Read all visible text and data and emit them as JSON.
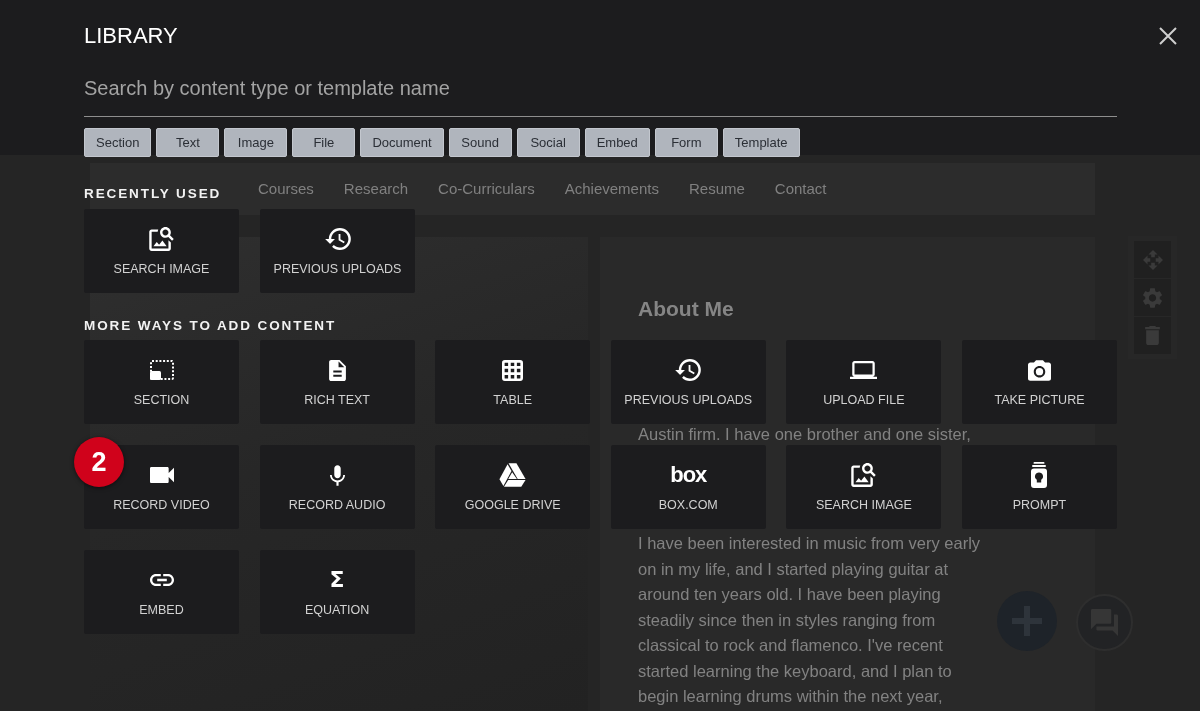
{
  "library": {
    "title": "LIBRARY",
    "search": {
      "placeholder": "Search by content type or template name"
    },
    "filters": [
      "Section",
      "Text",
      "Image",
      "File",
      "Document",
      "Sound",
      "Social",
      "Embed",
      "Form",
      "Template"
    ],
    "recently_used": {
      "heading": "RECENTLY USED",
      "tiles": [
        {
          "kind": "searchimage",
          "label": "SEARCH IMAGE"
        },
        {
          "kind": "uploads",
          "label": "PREVIOUS UPLOADS"
        }
      ]
    },
    "more_ways": {
      "heading": "MORE WAYS TO ADD CONTENT",
      "tiles": [
        {
          "kind": "section",
          "label": "SECTION"
        },
        {
          "kind": "richtext",
          "label": "RICH TEXT"
        },
        {
          "kind": "table",
          "label": "TABLE"
        },
        {
          "kind": "uploads",
          "label": "PREVIOUS UPLOADS"
        },
        {
          "kind": "uploadfile",
          "label": "UPLOAD FILE"
        },
        {
          "kind": "takepicture",
          "label": "TAKE PICTURE"
        },
        {
          "kind": "recordvideo",
          "label": "RECORD VIDEO",
          "badge": "2"
        },
        {
          "kind": "recordaudio",
          "label": "RECORD AUDIO"
        },
        {
          "kind": "drive",
          "label": "GOOGLE DRIVE"
        },
        {
          "kind": "wordmark",
          "glyph": "box",
          "label": "BOX.COM"
        },
        {
          "kind": "searchimage",
          "label": "SEARCH IMAGE"
        },
        {
          "kind": "prompt",
          "label": "PROMPT"
        },
        {
          "kind": "embed",
          "label": "EMBED"
        },
        {
          "kind": "symbol",
          "glyph": "Σ",
          "label": "EQUATION"
        }
      ]
    }
  },
  "background_page": {
    "nav": [
      "Courses",
      "Research",
      "Co-Curriculars",
      "Achievements",
      "Resume",
      "Contact"
    ],
    "about": {
      "heading": "About Me",
      "visible_line": "Austin firm. I have one brother and one sister,",
      "paragraph": [
        "I have been interested in music from very early",
        "on in my life, and I started playing guitar at",
        "around ten years old. I have been playing",
        "steadily since then in styles ranging from",
        "classical to rock and flamenco. I've recent",
        "started learning the keyboard, and I plan to",
        "begin learning drums within the next year,"
      ]
    }
  }
}
